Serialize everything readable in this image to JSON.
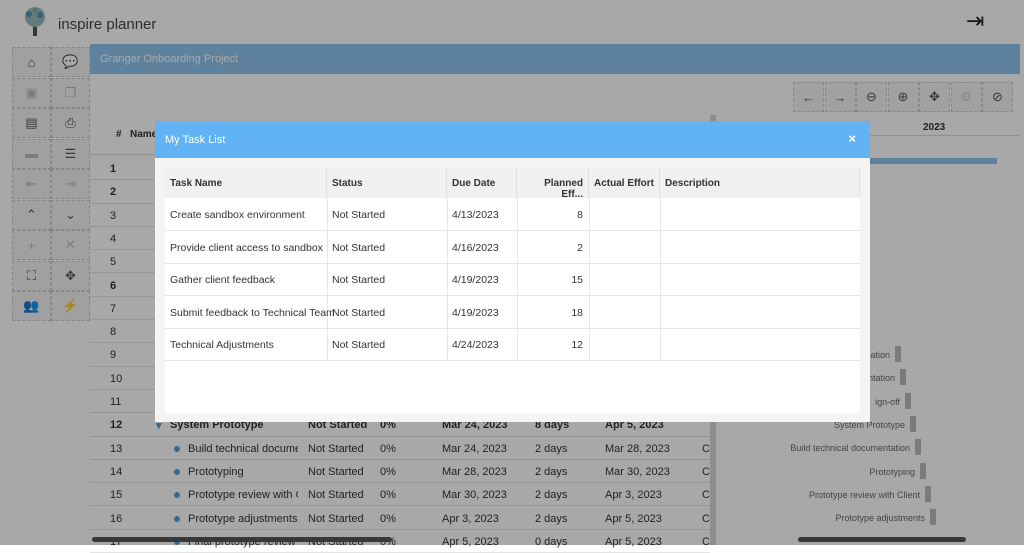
{
  "app": {
    "brand": "inspire planner",
    "project_title": "Granger Onboarding Project"
  },
  "sidebar": {
    "icons": [
      "home-icon",
      "chat-icon",
      "save-icon",
      "copy-icon",
      "excel-icon",
      "print-icon",
      "folder-icon",
      "list-icon",
      "outdent-icon",
      "indent-icon",
      "collapse-all-icon",
      "expand-all-icon",
      "add-icon",
      "delete-icon",
      "fullscreen-icon",
      "move-icon",
      "users-icon",
      "bolt-icon"
    ]
  },
  "toolbar": {
    "icons": [
      "arrow-left-icon",
      "arrow-right-icon",
      "zoom-out-icon",
      "zoom-in-icon",
      "move-icon",
      "gear-icon",
      "hide-icon"
    ]
  },
  "grid": {
    "headers": {
      "num": "#",
      "name": "Name"
    },
    "year": "2023",
    "row_numbers": [
      "1",
      "2",
      "3",
      "4",
      "5",
      "6",
      "7",
      "8",
      "9",
      "10",
      "11"
    ],
    "rows": [
      {
        "n": "12",
        "name": "System Prototype",
        "status": "Not Started",
        "pct": "0%",
        "start": "Mar 24, 2023",
        "dur": "8 days",
        "end": "Apr 5, 2023",
        "c": "",
        "bold": true
      },
      {
        "n": "13",
        "name": "Build technical documenta",
        "status": "Not Started",
        "pct": "0%",
        "start": "Mar 24, 2023",
        "dur": "2 days",
        "end": "Mar 28, 2023",
        "c": "C"
      },
      {
        "n": "14",
        "name": "Prototyping",
        "status": "Not Started",
        "pct": "0%",
        "start": "Mar 28, 2023",
        "dur": "2 days",
        "end": "Mar 30, 2023",
        "c": "C"
      },
      {
        "n": "15",
        "name": "Prototype review with Clien",
        "status": "Not Started",
        "pct": "0%",
        "start": "Mar 30, 2023",
        "dur": "2 days",
        "end": "Apr 3, 2023",
        "c": "C"
      },
      {
        "n": "16",
        "name": "Prototype adjustments",
        "status": "Not Started",
        "pct": "0%",
        "start": "Apr 3, 2023",
        "dur": "2 days",
        "end": "Apr 5, 2023",
        "c": "C"
      },
      {
        "n": "17",
        "name": "Final prototype review",
        "status": "Not Started",
        "pct": "0%",
        "start": "Apr 5, 2023",
        "dur": "0 days",
        "end": "Apr 5, 2023",
        "c": "C"
      }
    ],
    "gantt_labels": [
      "ation",
      "ntation",
      "ign-off",
      "System Prototype",
      "Build technical documentation",
      "Prototyping",
      "Prototype review with Client",
      "Prototype adjustments"
    ]
  },
  "modal": {
    "title": "My Task List",
    "close": "×",
    "columns": [
      "Task Name",
      "Status",
      "Due Date",
      "Planned Eff...",
      "Actual Effort",
      "Description"
    ],
    "rows": [
      {
        "task": "Create sandbox environment",
        "status": "Not Started",
        "due": "4/13/2023",
        "planned": "8",
        "actual": "",
        "desc": ""
      },
      {
        "task": "Provide client access to sandbox",
        "status": "Not Started",
        "due": "4/16/2023",
        "planned": "2",
        "actual": "",
        "desc": ""
      },
      {
        "task": "Gather client feedback",
        "status": "Not Started",
        "due": "4/19/2023",
        "planned": "15",
        "actual": "",
        "desc": ""
      },
      {
        "task": "Submit feedback to Technical Team",
        "status": "Not Started",
        "due": "4/19/2023",
        "planned": "18",
        "actual": "",
        "desc": ""
      },
      {
        "task": "Technical Adjustments",
        "status": "Not Started",
        "due": "4/24/2023",
        "planned": "12",
        "actual": "",
        "desc": ""
      }
    ]
  },
  "colors": {
    "accent": "#62b3f5",
    "project_bar": "#8fc4ee"
  }
}
